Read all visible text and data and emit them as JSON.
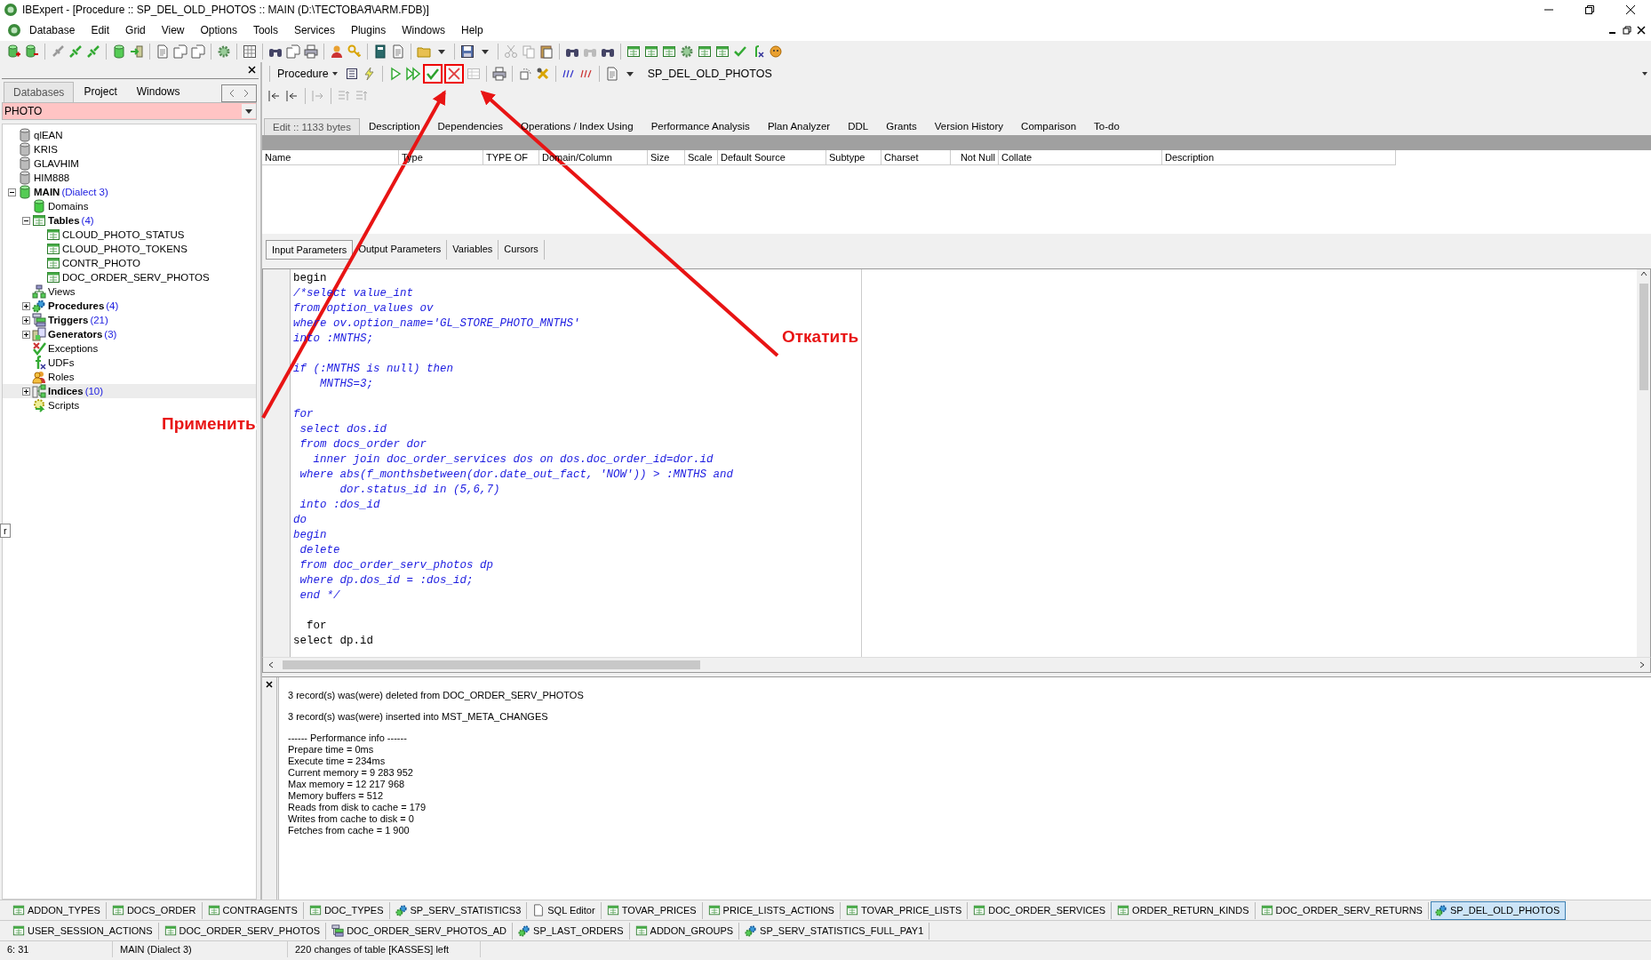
{
  "window": {
    "title": "IBExpert - [Procedure :: SP_DEL_OLD_PHOTOS :: MAIN (D:\\ТЕСТОВАЯ\\ARM.FDB)]"
  },
  "menu": [
    "Database",
    "Edit",
    "Grid",
    "View",
    "Options",
    "Tools",
    "Services",
    "Plugins",
    "Windows",
    "Help"
  ],
  "left_panel": {
    "tabs": [
      {
        "label": "Databases",
        "selected": true
      },
      {
        "label": "Project",
        "selected": false
      },
      {
        "label": "Windows",
        "selected": false
      }
    ],
    "filter": {
      "value": "PHOTO"
    },
    "tree": [
      {
        "label": "qlEAN",
        "kind": "server",
        "bold": false,
        "selected": false
      },
      {
        "label": "KRIS",
        "kind": "server",
        "bold": false,
        "selected": false
      },
      {
        "label": "GLAVHIM",
        "kind": "server",
        "bold": false,
        "selected": false
      },
      {
        "label": "HIM888",
        "kind": "server",
        "bold": false,
        "selected": false
      },
      {
        "label": "MAIN",
        "count": "(Dialect 3)",
        "kind": "database",
        "bold": true,
        "selected": false,
        "expanded": true,
        "children": [
          {
            "label": "Domains",
            "kind": "domain",
            "bold": false,
            "selected": false
          },
          {
            "label": "Tables",
            "count": "(4)",
            "kind": "table",
            "bold": true,
            "selected": false,
            "expanded": true,
            "children": [
              {
                "label": "CLOUD_PHOTO_STATUS",
                "kind": "table",
                "bold": false,
                "selected": false
              },
              {
                "label": "CLOUD_PHOTO_TOKENS",
                "kind": "table",
                "bold": false,
                "selected": false
              },
              {
                "label": "CONTR_PHOTO",
                "kind": "table",
                "bold": false,
                "selected": false
              },
              {
                "label": "DOC_ORDER_SERV_PHOTOS",
                "kind": "table",
                "bold": false,
                "selected": false
              }
            ]
          },
          {
            "label": "Views",
            "kind": "view",
            "bold": false,
            "selected": false
          },
          {
            "label": "Procedures",
            "count": "(4)",
            "kind": "procedure",
            "bold": true,
            "selected": false,
            "expanded": false
          },
          {
            "label": "Triggers",
            "count": "(21)",
            "kind": "trigger",
            "bold": true,
            "selected": false,
            "expanded": false
          },
          {
            "label": "Generators",
            "count": "(3)",
            "kind": "generator",
            "bold": true,
            "selected": false,
            "expanded": false
          },
          {
            "label": "Exceptions",
            "kind": "exception",
            "bold": false,
            "selected": false
          },
          {
            "label": "UDFs",
            "kind": "udf",
            "bold": false,
            "selected": false
          },
          {
            "label": "Roles",
            "kind": "role",
            "bold": false,
            "selected": false
          },
          {
            "label": "Indices",
            "count": "(10)",
            "kind": "index",
            "bold": true,
            "selected": true,
            "expanded": false
          },
          {
            "label": "Scripts",
            "kind": "script",
            "bold": false,
            "selected": false
          }
        ]
      }
    ]
  },
  "editor": {
    "object_type": "Procedure",
    "object_name": "SP_DEL_OLD_PHOTOS",
    "tabs": [
      {
        "label": "Edit :: 1133 bytes",
        "selected": true
      },
      {
        "label": "Description",
        "selected": false
      },
      {
        "label": "Dependencies",
        "selected": false
      },
      {
        "label": "Operations / Index Using",
        "selected": false
      },
      {
        "label": "Performance Analysis",
        "selected": false
      },
      {
        "label": "Plan Analyzer",
        "selected": false
      },
      {
        "label": "DDL",
        "selected": false
      },
      {
        "label": "Grants",
        "selected": false
      },
      {
        "label": "Version History",
        "selected": false
      },
      {
        "label": "Comparison",
        "selected": false
      },
      {
        "label": "To-do",
        "selected": false
      }
    ],
    "grid_columns": [
      "Name",
      "Type",
      "TYPE OF",
      "Domain/Column",
      "Size",
      "Scale",
      "Default Source",
      "Subtype",
      "Charset",
      "Not Null",
      "Collate",
      "Description"
    ],
    "param_tabs": [
      {
        "label": "Input Parameters",
        "selected": true
      },
      {
        "label": "Output Parameters",
        "selected": false
      },
      {
        "label": "Variables",
        "selected": false
      },
      {
        "label": "Cursors",
        "selected": false
      }
    ],
    "code": [
      {
        "kind": "plain",
        "text": "begin"
      },
      {
        "kind": "comment",
        "text": "/*select value_int"
      },
      {
        "kind": "comment",
        "text": "from option_values ov"
      },
      {
        "kind": "comment",
        "text": "where ov.option_name='GL_STORE_PHOTO_MNTHS'"
      },
      {
        "kind": "comment",
        "text": "into :MNTHS;"
      },
      {
        "kind": "blank"
      },
      {
        "kind": "comment",
        "text": "if (:MNTHS is null) then"
      },
      {
        "kind": "comment",
        "text": "    MNTHS=3;"
      },
      {
        "kind": "blank"
      },
      {
        "kind": "comment",
        "text": "for"
      },
      {
        "kind": "comment",
        "text": " select dos.id"
      },
      {
        "kind": "comment",
        "text": " from docs_order dor"
      },
      {
        "kind": "comment",
        "text": "   inner join doc_order_services dos on dos.doc_order_id=dor.id"
      },
      {
        "kind": "comment",
        "text": " where abs(f_monthsbetween(dor.date_out_fact, 'NOW')) > :MNTHS and"
      },
      {
        "kind": "comment",
        "text": "       dor.status_id in (5,6,7)"
      },
      {
        "kind": "comment",
        "text": " into :dos_id"
      },
      {
        "kind": "comment",
        "text": "do"
      },
      {
        "kind": "comment",
        "text": "begin"
      },
      {
        "kind": "comment",
        "text": " delete"
      },
      {
        "kind": "comment",
        "text": " from doc_order_serv_photos dp"
      },
      {
        "kind": "comment",
        "text": " where dp.dos_id = :dos_id;"
      },
      {
        "kind": "comment",
        "text": " end */"
      },
      {
        "kind": "blank"
      },
      {
        "kind": "plain",
        "text": "  for"
      },
      {
        "kind": "plain",
        "text": "select dp.id"
      }
    ]
  },
  "messages": [
    "3 record(s) was(were) deleted from DOC_ORDER_SERV_PHOTOS",
    "3 record(s) was(were) inserted into MST_META_CHANGES"
  ],
  "performance": {
    "title": "------ Performance info ------",
    "lines": [
      "Prepare time = 0ms",
      "Execute time = 234ms",
      "Current memory = 9 283 952",
      "Max memory = 12 217 968",
      "Memory buffers = 512",
      "Reads from disk to cache = 179",
      "Writes from cache to disk = 0",
      "Fetches from cache = 1 900"
    ]
  },
  "window_tabs": [
    [
      {
        "label": "ADDON_TYPES",
        "kind": "table",
        "selected": false
      },
      {
        "label": "DOCS_ORDER",
        "kind": "table",
        "selected": false
      },
      {
        "label": "CONTRAGENTS",
        "kind": "table",
        "selected": false
      },
      {
        "label": "DOC_TYPES",
        "kind": "table",
        "selected": false
      },
      {
        "label": "SP_SERV_STATISTICS3",
        "kind": "procedure",
        "selected": false
      },
      {
        "label": "SQL Editor",
        "kind": "editor",
        "selected": false
      },
      {
        "label": "TOVAR_PRICES",
        "kind": "table",
        "selected": false
      },
      {
        "label": "PRICE_LISTS_ACTIONS",
        "kind": "table",
        "selected": false
      },
      {
        "label": "TOVAR_PRICE_LISTS",
        "kind": "table",
        "selected": false
      },
      {
        "label": "DOC_ORDER_SERVICES",
        "kind": "table",
        "selected": false
      },
      {
        "label": "ORDER_RETURN_KINDS",
        "kind": "table",
        "selected": false
      },
      {
        "label": "DOC_ORDER_SERV_RETURNS",
        "kind": "table",
        "selected": false
      },
      {
        "label": "SP_DEL_OLD_PHOTOS",
        "kind": "procedure",
        "selected": true
      }
    ],
    [
      {
        "label": "USER_SESSION_ACTIONS",
        "kind": "table",
        "selected": false
      },
      {
        "label": "DOC_ORDER_SERV_PHOTOS",
        "kind": "table",
        "selected": false
      },
      {
        "label": "DOC_ORDER_SERV_PHOTOS_AD",
        "kind": "trigger",
        "selected": false
      },
      {
        "label": "SP_LAST_ORDERS",
        "kind": "procedure",
        "selected": false
      },
      {
        "label": "ADDON_GROUPS",
        "kind": "table",
        "selected": false
      },
      {
        "label": "SP_SERV_STATISTICS_FULL_PAY1",
        "kind": "procedure",
        "selected": false
      }
    ]
  ],
  "status_bar": [
    "6:  31",
    "MAIN (Dialect 3)",
    "220 changes of table [KASSES] left"
  ],
  "side_tab": "r",
  "annotations": [
    "Применить",
    "Откатить"
  ]
}
